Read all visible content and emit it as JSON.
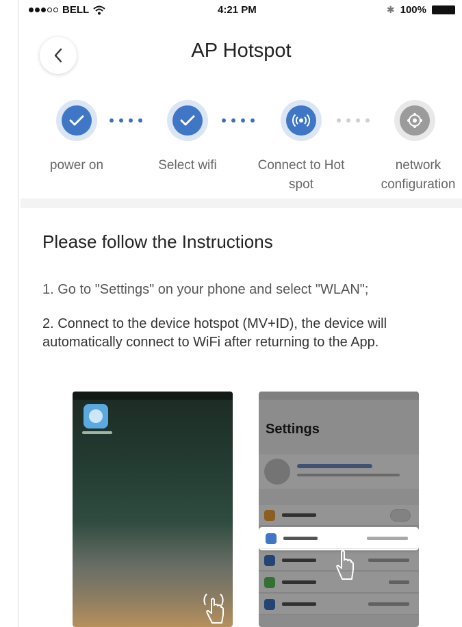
{
  "status_bar": {
    "carrier": "BELL",
    "time": "4:21 PM",
    "battery": "100%"
  },
  "header": {
    "title": "AP Hotspot"
  },
  "steps": [
    {
      "label": "power on",
      "state": "done"
    },
    {
      "label": "Select wifi",
      "state": "done"
    },
    {
      "label": "Connect to Hot spot",
      "state": "current"
    },
    {
      "label": "network configuration",
      "state": "pending"
    }
  ],
  "instructions": {
    "title": "Please follow the Instructions",
    "step1": "1. Go to \"Settings\" on your phone and select \"WLAN\";",
    "step2": "2. Connect to the device hotspot (MV+ID), the device will automatically connect to WiFi after returning to the App."
  },
  "illustration": {
    "settings_title": "Settings"
  },
  "colors": {
    "accent": "#3f77c6",
    "pending": "#9b9b9b"
  }
}
